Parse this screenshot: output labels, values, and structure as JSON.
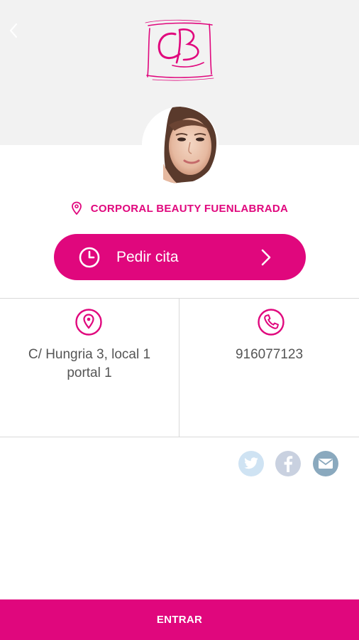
{
  "header": {
    "back_icon": "chevron-left-icon",
    "logo_letters": "CB"
  },
  "location": {
    "icon": "map-pin-icon",
    "name": "CORPORAL BEAUTY FUENLABRADA"
  },
  "appointment_button": {
    "icon": "clock-icon",
    "label": "Pedir cita",
    "arrow_icon": "chevron-right-icon"
  },
  "contact": {
    "address": {
      "icon": "location-pin-icon",
      "text": "C/ Hungria 3, local 1\nportal 1"
    },
    "phone": {
      "icon": "phone-icon",
      "text": "916077123"
    }
  },
  "social": [
    {
      "name": "twitter",
      "icon": "twitter-icon",
      "color": "#cfe3f3"
    },
    {
      "name": "facebook",
      "icon": "facebook-icon",
      "color": "#c9d1e0"
    },
    {
      "name": "email",
      "icon": "email-icon",
      "color": "#8aa9be"
    }
  ],
  "footer": {
    "button_label": "ENTRAR"
  },
  "colors": {
    "accent": "#e0077d",
    "header_bg": "#f2f2f2",
    "text": "#555555",
    "divider": "#d9d9d9"
  }
}
